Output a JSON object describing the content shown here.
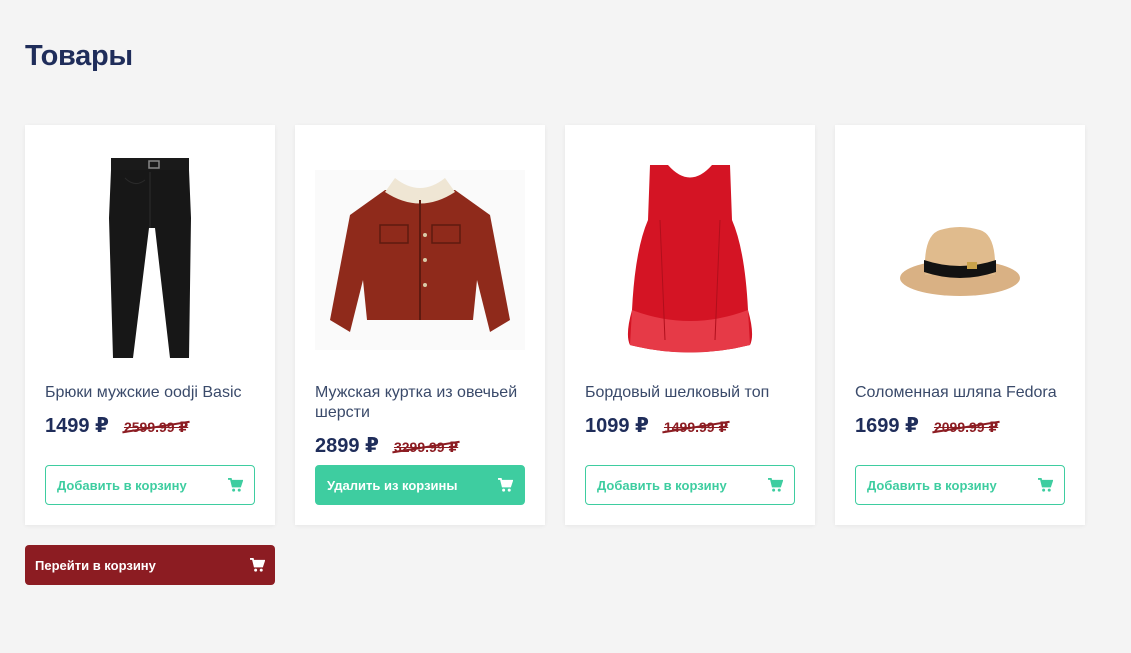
{
  "page": {
    "title": "Товары"
  },
  "colors": {
    "navy": "#1f2d5a",
    "accent": "#3ecda0",
    "danger": "#8c1c22"
  },
  "products": [
    {
      "name": "Брюки мужские oodji Basic",
      "price": "1499 ₽",
      "old_price": "2599.99 ₽",
      "button": "Добавить в корзину",
      "in_cart": false,
      "image_icon": "trousers-image"
    },
    {
      "name": "Мужская куртка из овечьей шерсти",
      "price": "2899 ₽",
      "old_price": "3299.99 ₽",
      "button": "Удалить из корзины",
      "in_cart": true,
      "image_icon": "jacket-image"
    },
    {
      "name": "Бордовый шелковый топ",
      "price": "1099 ₽",
      "old_price": "1499.99 ₽",
      "button": "Добавить в корзину",
      "in_cart": false,
      "image_icon": "top-image"
    },
    {
      "name": "Соломенная шляпа Fedora",
      "price": "1699 ₽",
      "old_price": "2099.99 ₽",
      "button": "Добавить в корзину",
      "in_cart": false,
      "image_icon": "hat-image"
    }
  ],
  "footer": {
    "go_to_cart": "Перейти в корзину",
    "icon": "cart-icon"
  }
}
